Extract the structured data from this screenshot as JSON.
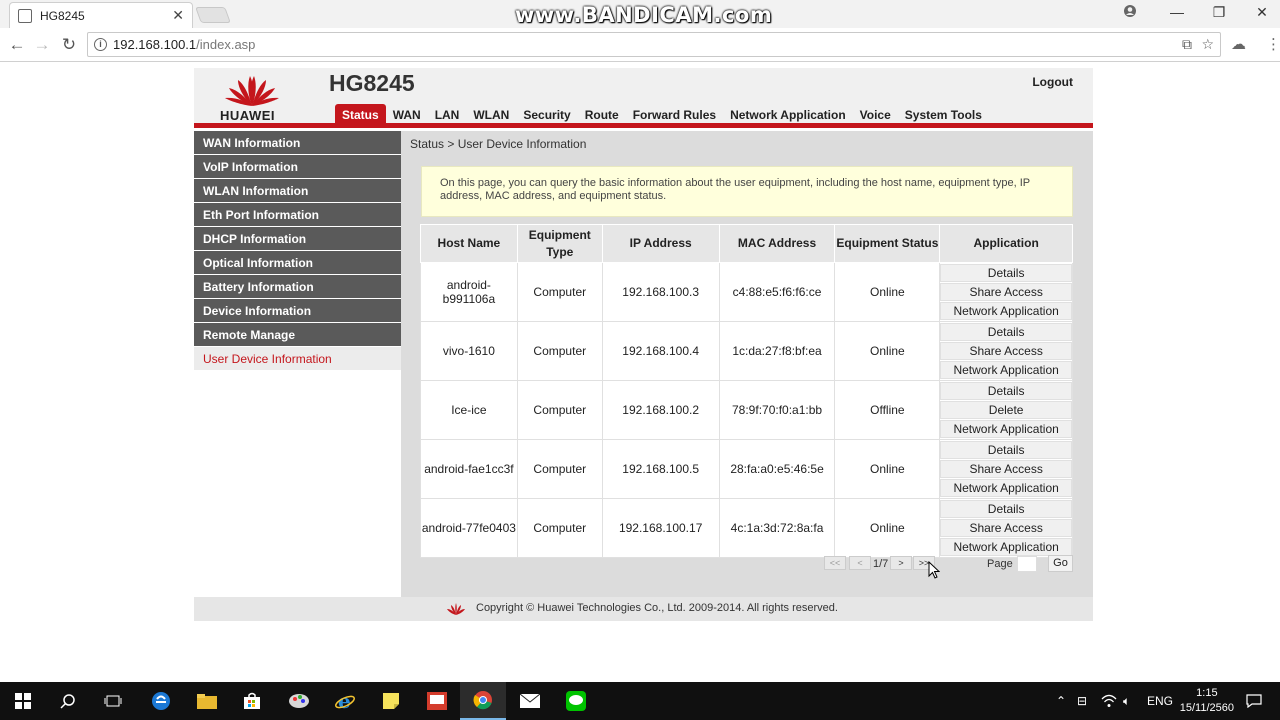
{
  "browser": {
    "tab_title": "HG8245",
    "tab_close": "✕",
    "watermark": "www.BANDICAM.com",
    "url_host": "192.168.100.1",
    "url_path": "/index.asp"
  },
  "router": {
    "logo_text": "HUAWEI",
    "model": "HG8245",
    "logout": "Logout",
    "nav": [
      "Status",
      "WAN",
      "LAN",
      "WLAN",
      "Security",
      "Route",
      "Forward Rules",
      "Network Application",
      "Voice",
      "System Tools"
    ],
    "sidebar": [
      "WAN Information",
      "VoIP Information",
      "WLAN Information",
      "Eth Port Information",
      "DHCP Information",
      "Optical Information",
      "Battery Information",
      "Device Information",
      "Remote Manage",
      "User Device Information"
    ],
    "breadcrumb": "Status > User Device Information",
    "notice": "On this page, you can query the basic information about the user equipment, including the host name, equipment type, IP address, MAC address, and equipment status.",
    "table": {
      "headers": [
        "Host Name",
        "Equipment Type",
        "IP Address",
        "MAC Address",
        "Equipment Status",
        "Application"
      ],
      "rows": [
        {
          "host": "android-b991106a",
          "type": "Computer",
          "ip": "192.168.100.3",
          "mac": "c4:88:e5:f6:f6:ce",
          "status": "Online",
          "apps": [
            "Details",
            "Share Access",
            "Network Application"
          ]
        },
        {
          "host": "vivo-1610",
          "type": "Computer",
          "ip": "192.168.100.4",
          "mac": "1c:da:27:f8:bf:ea",
          "status": "Online",
          "apps": [
            "Details",
            "Share Access",
            "Network Application"
          ]
        },
        {
          "host": "Ice-ice",
          "type": "Computer",
          "ip": "192.168.100.2",
          "mac": "78:9f:70:f0:a1:bb",
          "status": "Offline",
          "apps": [
            "Details",
            "Delete",
            "Network Application"
          ]
        },
        {
          "host": "android-fae1cc3f",
          "type": "Computer",
          "ip": "192.168.100.5",
          "mac": "28:fa:a0:e5:46:5e",
          "status": "Online",
          "apps": [
            "Details",
            "Share Access",
            "Network Application"
          ]
        },
        {
          "host": "android-77fe0403",
          "type": "Computer",
          "ip": "192.168.100.17",
          "mac": "4c:1a:3d:72:8a:fa",
          "status": "Online",
          "apps": [
            "Details",
            "Share Access",
            "Network Application"
          ]
        }
      ]
    },
    "pager": {
      "first": "<<",
      "prev": "<",
      "current": "1/7",
      "next": ">",
      "last": ">>",
      "page_label": "Page",
      "page_value": "",
      "go": "Go"
    },
    "footer": "Copyright © Huawei Technologies Co., Ltd. 2009-2014. All rights reserved."
  },
  "taskbar": {
    "lang": "ENG",
    "time": "1:15",
    "date": "15/11/2560"
  },
  "colors": {
    "brand_red": "#c4161c",
    "sidebar_gray": "#5a5a5a",
    "notice_bg": "#ffffdc"
  }
}
